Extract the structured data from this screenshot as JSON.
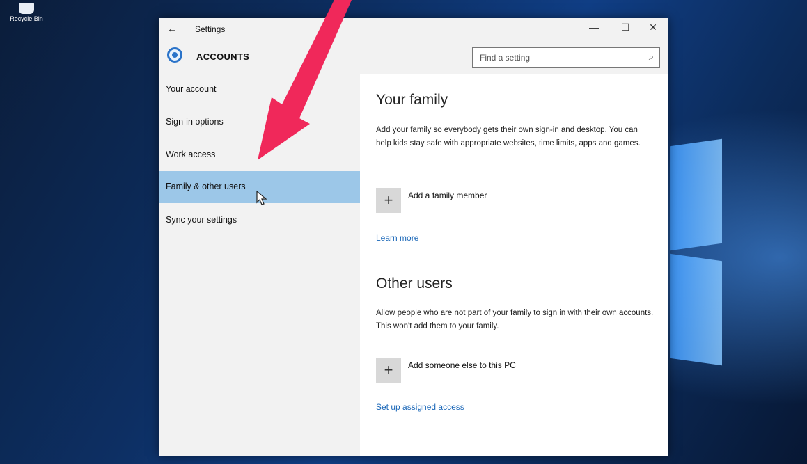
{
  "desktop": {
    "recycle_bin_label": "Recycle Bin"
  },
  "window": {
    "title": "Settings",
    "back_icon": "back-arrow-icon",
    "controls": {
      "minimize": "—",
      "maximize": "☐",
      "close": "✕"
    }
  },
  "header": {
    "section_title": "ACCOUNTS",
    "search": {
      "placeholder": "Find a setting",
      "icon": "search-icon"
    }
  },
  "sidebar": {
    "items": [
      {
        "label": "Your account"
      },
      {
        "label": "Sign-in options"
      },
      {
        "label": "Work access"
      },
      {
        "label": "Family & other users",
        "selected": true
      },
      {
        "label": "Sync your settings"
      }
    ]
  },
  "content": {
    "family": {
      "heading": "Your family",
      "description": "Add your family so everybody gets their own sign-in and desktop. You can help kids stay safe with appropriate websites, time limits, apps and games.",
      "add_label": "Add a family member",
      "add_glyph": "+",
      "learn_more": "Learn more"
    },
    "other_users": {
      "heading": "Other users",
      "description": "Allow people who are not part of your family to sign in with their own accounts. This won't add them to your family.",
      "add_label": "Add someone else to this PC",
      "add_glyph": "+",
      "assigned_access": "Set up assigned access"
    }
  },
  "colors": {
    "accent": "#2a73c9",
    "selected_row": "#9cc7e8",
    "link": "#1a67b8",
    "annotation_arrow": "#f0285a"
  }
}
